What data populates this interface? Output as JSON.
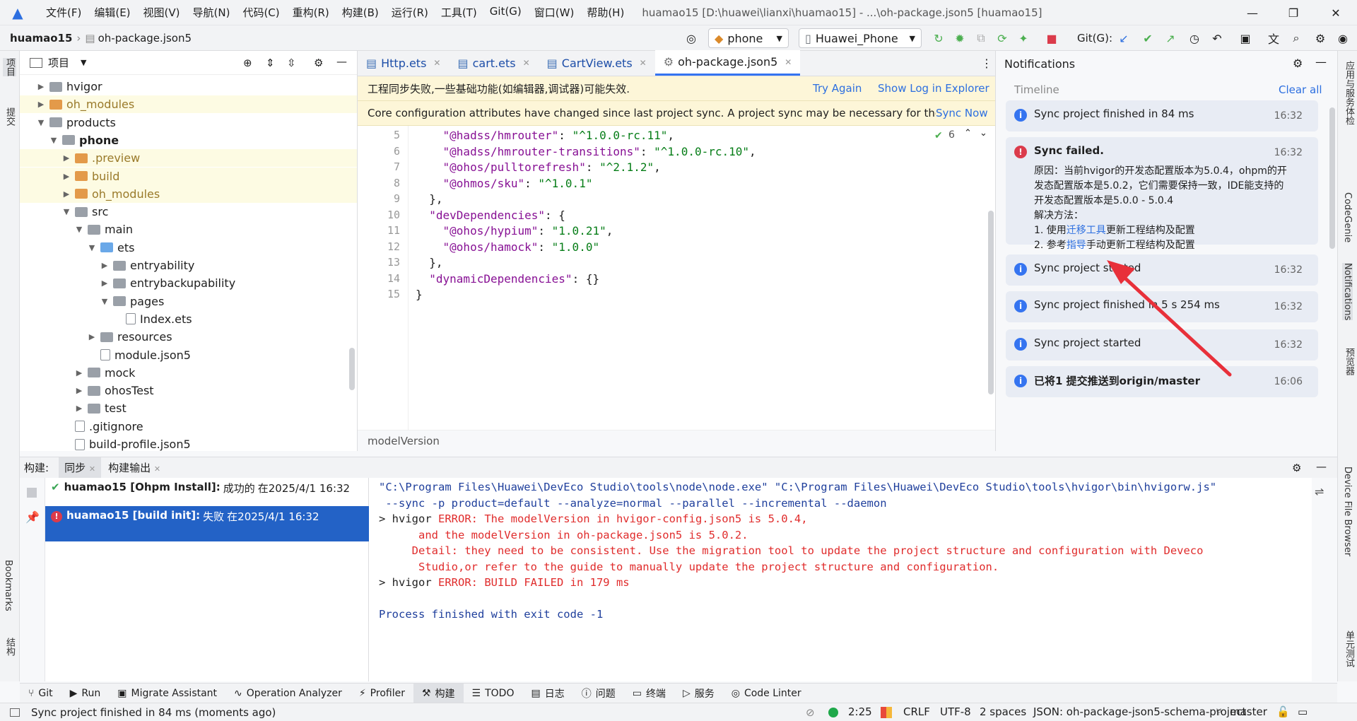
{
  "menubar": {
    "items": [
      "文件(F)",
      "编辑(E)",
      "视图(V)",
      "导航(N)",
      "代码(C)",
      "重构(R)",
      "构建(B)",
      "运行(R)",
      "工具(T)",
      "Git(G)",
      "窗口(W)",
      "帮助(H)"
    ],
    "window_title": "huamao15 [D:\\huawei\\lianxi\\huamao15] - ...\\oh-package.json5 [huamao15]"
  },
  "navbar": {
    "project": "huamao15",
    "file": "oh-package.json5",
    "module_combo": "phone",
    "device_combo": "Huawei_Phone",
    "git_label": "Git(G):"
  },
  "leftstrip": {
    "project": "项目",
    "commit": "提交",
    "bookmarks": "Bookmarks",
    "structure": "结构"
  },
  "rightstrip": {
    "app_services": "应用与服务体检",
    "codegenie": "CodeGenie",
    "notifications": "Notifications",
    "previewer": "预览器",
    "device_file_browser": "Device File Browser",
    "unit_test": "单元测试"
  },
  "project_panel": {
    "title": "项目",
    "tree": [
      {
        "label": "hvigor",
        "depth": 1,
        "arrow": "right",
        "icon": "folder",
        "hl": false
      },
      {
        "label": "oh_modules",
        "depth": 1,
        "arrow": "right",
        "icon": "folder-orange",
        "hl": true,
        "muted": true
      },
      {
        "label": "products",
        "depth": 1,
        "arrow": "down",
        "icon": "folder",
        "hl": false
      },
      {
        "label": "phone",
        "depth": 2,
        "arrow": "down",
        "icon": "folder",
        "hl": false,
        "bold": true
      },
      {
        "label": ".preview",
        "depth": 3,
        "arrow": "right",
        "icon": "folder-orange",
        "hl": true,
        "muted": true
      },
      {
        "label": "build",
        "depth": 3,
        "arrow": "right",
        "icon": "folder-orange",
        "hl": true,
        "muted": true
      },
      {
        "label": "oh_modules",
        "depth": 3,
        "arrow": "right",
        "icon": "folder-orange",
        "hl": true,
        "muted": true
      },
      {
        "label": "src",
        "depth": 3,
        "arrow": "down",
        "icon": "folder",
        "hl": false
      },
      {
        "label": "main",
        "depth": 4,
        "arrow": "down",
        "icon": "folder",
        "hl": false
      },
      {
        "label": "ets",
        "depth": 5,
        "arrow": "down",
        "icon": "folder-blue",
        "hl": false
      },
      {
        "label": "entryability",
        "depth": 6,
        "arrow": "right",
        "icon": "folder",
        "hl": false
      },
      {
        "label": "entrybackupability",
        "depth": 6,
        "arrow": "right",
        "icon": "folder",
        "hl": false
      },
      {
        "label": "pages",
        "depth": 6,
        "arrow": "down",
        "icon": "folder",
        "hl": false
      },
      {
        "label": "Index.ets",
        "depth": 7,
        "arrow": "",
        "icon": "file",
        "hl": false
      },
      {
        "label": "resources",
        "depth": 5,
        "arrow": "right",
        "icon": "folder",
        "hl": false
      },
      {
        "label": "module.json5",
        "depth": 5,
        "arrow": "",
        "icon": "file",
        "hl": false
      },
      {
        "label": "mock",
        "depth": 4,
        "arrow": "right",
        "icon": "folder",
        "hl": false
      },
      {
        "label": "ohosTest",
        "depth": 4,
        "arrow": "right",
        "icon": "folder",
        "hl": false
      },
      {
        "label": "test",
        "depth": 4,
        "arrow": "right",
        "icon": "folder",
        "hl": false
      },
      {
        "label": ".gitignore",
        "depth": 3,
        "arrow": "",
        "icon": "file",
        "hl": false
      },
      {
        "label": "build-profile.json5",
        "depth": 3,
        "arrow": "",
        "icon": "file",
        "hl": false
      }
    ]
  },
  "tabs": [
    "Http.ets",
    "cart.ets",
    "CartView.ets",
    "oh-package.json5"
  ],
  "banner1": {
    "text": "工程同步失败,一些基础功能(如编辑器,调试器)可能失效.",
    "try_again": "Try Again",
    "show_log": "Show Log in Explorer"
  },
  "banner2": {
    "text": "Core configuration attributes have changed since last project sync. A project sync may be necessary for the IDE",
    "sync_now": "Sync Now"
  },
  "editor": {
    "warnings": "6",
    "breadcrumb": "modelVersion",
    "lines": [
      {
        "n": "5",
        "indent": "    ",
        "key": "\"@hadss/hmrouter\"",
        "sep": ": ",
        "val": "\"^1.0.0-rc.11\"",
        "tail": ","
      },
      {
        "n": "6",
        "indent": "    ",
        "key": "\"@hadss/hmrouter-transitions\"",
        "sep": ": ",
        "val": "\"^1.0.0-rc.10\"",
        "tail": ","
      },
      {
        "n": "7",
        "indent": "    ",
        "key": "\"@ohos/pulltorefresh\"",
        "sep": ": ",
        "val": "\"^2.1.2\"",
        "tail": ","
      },
      {
        "n": "8",
        "indent": "    ",
        "key": "\"@ohmos/sku\"",
        "sep": ": ",
        "val": "\"^1.0.1\"",
        "tail": ""
      },
      {
        "n": "9",
        "indent": "  ",
        "key": "",
        "sep": "",
        "val": "",
        "tail": "},"
      },
      {
        "n": "10",
        "indent": "  ",
        "key": "\"devDependencies\"",
        "sep": ": ",
        "val": "",
        "tail": "{"
      },
      {
        "n": "11",
        "indent": "    ",
        "key": "\"@ohos/hypium\"",
        "sep": ": ",
        "val": "\"1.0.21\"",
        "tail": ","
      },
      {
        "n": "12",
        "indent": "    ",
        "key": "\"@ohos/hamock\"",
        "sep": ": ",
        "val": "\"1.0.0\"",
        "tail": ""
      },
      {
        "n": "13",
        "indent": "  ",
        "key": "",
        "sep": "",
        "val": "",
        "tail": "},"
      },
      {
        "n": "14",
        "indent": "  ",
        "key": "\"dynamicDependencies\"",
        "sep": ": ",
        "val": "",
        "tail": "{}"
      },
      {
        "n": "15",
        "indent": "",
        "key": "",
        "sep": "",
        "val": "",
        "tail": "}"
      }
    ]
  },
  "notifications": {
    "title": "Notifications",
    "timeline": "Timeline",
    "clear_all": "Clear all",
    "cards": [
      {
        "kind": "info",
        "title": "Sync project finished in 84 ms",
        "time": "16:32"
      },
      {
        "kind": "error",
        "title": "Sync failed.",
        "time": "16:32",
        "body": [
          "原因：当前hvigor的开发态配置版本为5.0.4，ohpm的开",
          "发态配置版本是5.0.2，它们需要保持一致，IDE能支持的",
          "开发态配置版本是5.0.0 - 5.0.4",
          "解决方法："
        ],
        "step1_a": "1. 使用",
        "step1_link": "迁移工具",
        "step1_b": "更新工程结构及配置",
        "step2_a": "2. 参考",
        "step2_link": "指导",
        "step2_b": "手动更新工程结构及配置"
      },
      {
        "kind": "info",
        "title": "Sync project started",
        "time": "16:32"
      },
      {
        "kind": "info",
        "title": "Sync project finished in 5 s 254 ms",
        "time": "16:32"
      },
      {
        "kind": "info",
        "title": "Sync project started",
        "time": "16:32"
      },
      {
        "kind": "info",
        "title": "已将1 提交推送到origin/master",
        "time": "16:06"
      }
    ]
  },
  "build": {
    "label": "构建:",
    "tab_sync": "同步",
    "tab_output": "构建输出",
    "rows": [
      {
        "name": "huamao15 [Ohpm Install]:",
        "status": "成功的",
        "when": "在2025/4/1 16:32"
      },
      {
        "name": "huamao15 [build init]:",
        "status": "失败",
        "when": "在2025/4/1 16:32"
      }
    ],
    "console": [
      {
        "cls": "bl",
        "text": "\"C:\\Program Files\\Huawei\\DevEco Studio\\tools\\node\\node.exe\" \"C:\\Program Files\\Huawei\\DevEco Studio\\tools\\hvigor\\bin\\hvigorw.js\""
      },
      {
        "cls": "bl",
        "text": " --sync -p product=default --analyze=normal --parallel --incremental --daemon"
      },
      {
        "cls": "mix",
        "pre": "> hvigor ",
        "text": "ERROR: The modelVersion in hvigor-config.json5 is 5.0.4,"
      },
      {
        "cls": "rd",
        "text": "      and the modelVersion in oh-package.json5 is 5.0.2."
      },
      {
        "cls": "rd",
        "text": "     Detail: they need to be consistent. Use the migration tool to update the project structure and configuration with Deveco"
      },
      {
        "cls": "rd",
        "text": "      Studio,or refer to the guide to manually update the project structure and configuration."
      },
      {
        "cls": "mix",
        "pre": "> hvigor ",
        "text": "ERROR: BUILD FAILED in 179 ms"
      },
      {
        "cls": "bl",
        "text": ""
      },
      {
        "cls": "bl",
        "text": "Process finished with exit code -1"
      }
    ]
  },
  "tooltabs": [
    "Git",
    "Run",
    "Migrate Assistant",
    "Operation Analyzer",
    "Profiler",
    "构建",
    "TODO",
    "日志",
    "问题",
    "终端",
    "服务",
    "Code Linter"
  ],
  "statusbar": {
    "message": "Sync project finished in 84 ms (moments ago)",
    "position": "2:25",
    "line_sep": "CRLF",
    "encoding": "UTF-8",
    "indent": "2 spaces",
    "schema": "JSON: oh-package-json5-schema-project",
    "branch": "master"
  },
  "colors": {
    "accent": "#3574f0",
    "error": "#db3b4b",
    "link": "#2d6fe0",
    "arrow": "#e8303a"
  }
}
